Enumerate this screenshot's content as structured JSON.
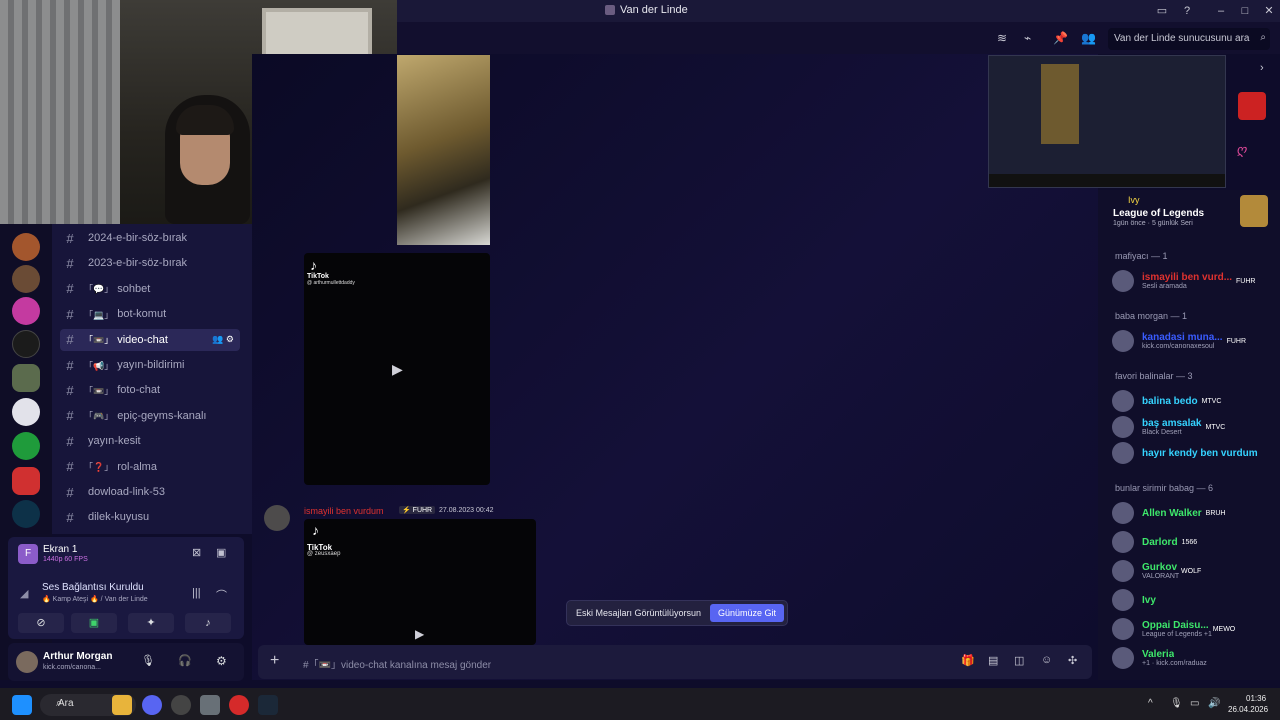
{
  "window": {
    "title": "Van der Linde"
  },
  "search": {
    "placeholder": "Van der Linde sunucusunu ara"
  },
  "channels": [
    {
      "name": "2024-e-bir-söz-bırak",
      "emoji": ""
    },
    {
      "name": "2023-e-bir-söz-bırak",
      "emoji": ""
    },
    {
      "name": "sohbet",
      "emoji": "「💬」"
    },
    {
      "name": "bot-komut",
      "emoji": "「💻」"
    },
    {
      "name": "video-chat",
      "emoji": "「📼」",
      "active": true
    },
    {
      "name": "yayın-bildirimi",
      "emoji": "「📢」"
    },
    {
      "name": "foto-chat",
      "emoji": "「📼」"
    },
    {
      "name": "epiç-geyms-kanalı",
      "emoji": "「🎮」"
    },
    {
      "name": "yayın-kesit",
      "emoji": ""
    },
    {
      "name": "rol-alma",
      "emoji": "「❓」"
    },
    {
      "name": "dowload-link-53",
      "emoji": ""
    },
    {
      "name": "dilek-kuyusu",
      "emoji": ""
    }
  ],
  "stream": {
    "title": "Ekran 1",
    "quality": "1440p 60 FPS"
  },
  "voice": {
    "status": "Ses Bağlantısı Kuruldu",
    "location": "🔥 Kamp Ateşi 🔥 / Van der Linde"
  },
  "user": {
    "name": "Arthur Morgan",
    "status": "kick.com/canona..."
  },
  "messages": {
    "tiktok1_brand": "TikTok",
    "tiktok1_handle": "@ arthurmullettdaddy",
    "author": "ismayili ben vurdum",
    "author_tag": "FUHR",
    "timestamp": "27.08.2023 00:42",
    "tiktok2_brand": "TikTok",
    "tiktok2_handle": "@ zeusxaep"
  },
  "toast": {
    "text": "Eski Mesajları Görüntülüyorsun",
    "button": "Günümüze Git"
  },
  "composer": {
    "placeholder": "#「📼」video-chat kanalına mesaj gönder"
  },
  "activity": {
    "user": "Ivy",
    "game": "League of Legends",
    "time": "1gün önce",
    "streak": "5 günlük Seri"
  },
  "member_groups": [
    {
      "title": "mafiyacı — 1",
      "members": [
        {
          "name": "ismayili ben vurd...",
          "tag": "FUHR",
          "sub": "Sesli aramada",
          "color": "#e0322f"
        }
      ]
    },
    {
      "title": "baba morgan — 1",
      "members": [
        {
          "name": "kanadasi muna...",
          "tag": "FUHR",
          "sub": "kick.com/canonaxesoul",
          "color": "#3a5cff"
        }
      ]
    },
    {
      "title": "favori balinalar — 3",
      "members": [
        {
          "name": "balina bedo",
          "tag": "MTVC",
          "sub": "",
          "color": "#35d3ff"
        },
        {
          "name": "baş amsalak",
          "tag": "MTVC",
          "sub": "Black Desert",
          "color": "#35d3ff"
        },
        {
          "name": "hayır kendy ben vurdum",
          "tag": "",
          "sub": "",
          "color": "#35d3ff"
        }
      ]
    },
    {
      "title": "bunlar sirimir babag — 6",
      "members": [
        {
          "name": "Allen Walker",
          "tag": "BRUH",
          "sub": "",
          "color": "#3ee86b"
        },
        {
          "name": "Darlord",
          "tag": "1566",
          "sub": "",
          "color": "#3ee86b"
        },
        {
          "name": "Gurkov",
          "tag": "WOLF",
          "sub": "VALORANT",
          "color": "#3ee86b"
        },
        {
          "name": "Ivy",
          "tag": "",
          "sub": "",
          "color": "#3ee86b"
        },
        {
          "name": "Oppai Daisu...",
          "tag": "MEWO",
          "sub": "League of Legends +1",
          "color": "#3ee86b"
        },
        {
          "name": "Valeria",
          "tag": "",
          "sub": "+1 · kick.com/raduaz",
          "color": "#3ee86b"
        }
      ]
    }
  ],
  "taskbar": {
    "search": "Ara",
    "time": "01:36",
    "date": "26.04.2026"
  },
  "colors": {
    "accent": "#5865f2",
    "bg": "#0e0c2a",
    "red_name": "#e0322f",
    "cyan_name": "#35d3ff",
    "green_name": "#3ee86b"
  }
}
